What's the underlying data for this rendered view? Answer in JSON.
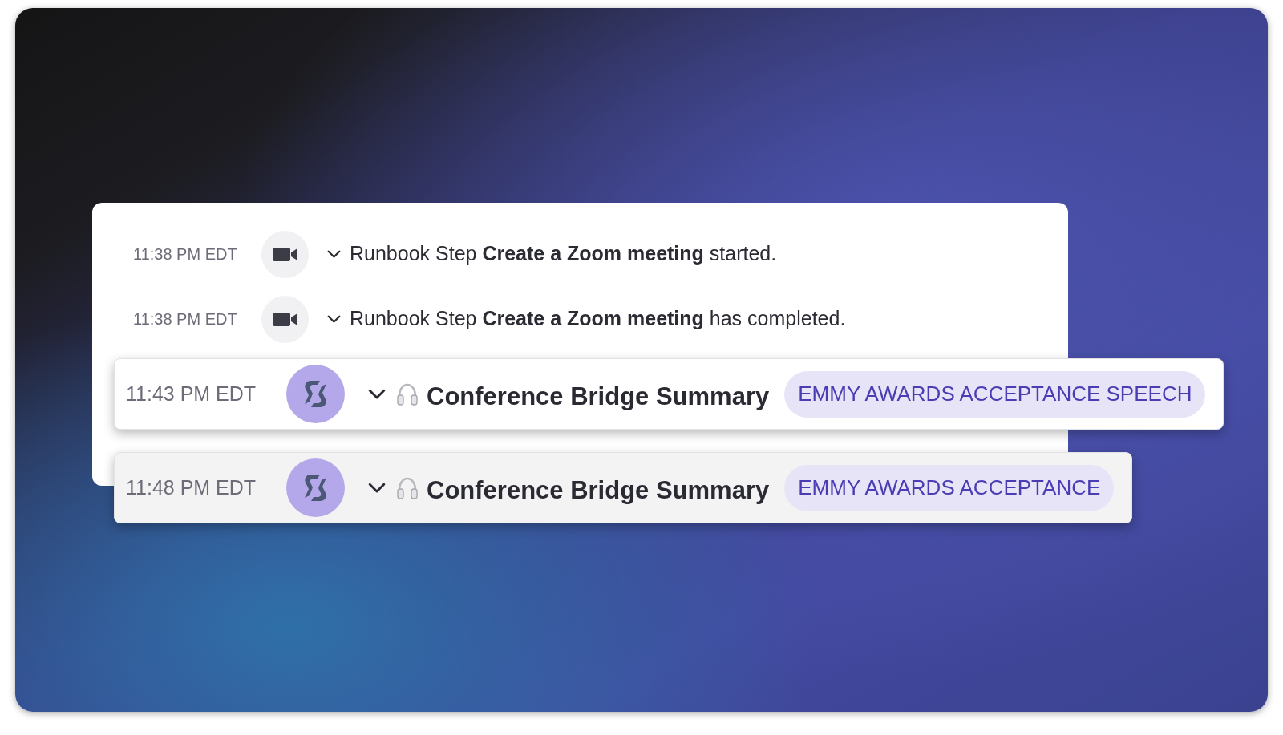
{
  "steps": [
    {
      "time": "11:38 PM EDT",
      "text": "Runbook Step **Create a Zoom meeting** started."
    },
    {
      "time": "11:38 PM EDT",
      "text": "Runbook Step **Create a Zoom meeting** has completed."
    }
  ],
  "summaries": [
    {
      "time": "11:43 PM EDT",
      "title": "Conference Bridge Summary",
      "tag": "EMMY AWARDS ACCEPTANCE SPEECH",
      "selected": true
    },
    {
      "time": "11:48 PM EDT",
      "title": "Conference Bridge Summary",
      "tag": "EMMY AWARDS ACCEPTANCE",
      "selected": false
    }
  ]
}
